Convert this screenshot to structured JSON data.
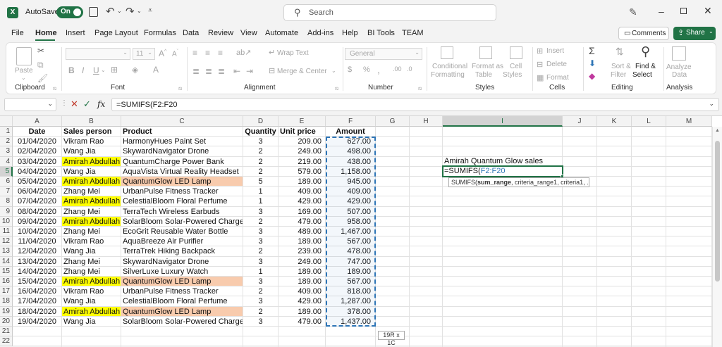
{
  "titlebar": {
    "autosave_label": "AutoSave",
    "toggle_label": "On",
    "search_placeholder": "Search"
  },
  "menu": {
    "tabs": [
      "File",
      "Home",
      "Insert",
      "Page Layout",
      "Formulas",
      "Data",
      "Review",
      "View",
      "Automate",
      "Add-ins",
      "Help",
      "BI Tools",
      "TEAM"
    ],
    "active": "Home",
    "comments_label": "Comments",
    "share_label": "Share"
  },
  "ribbon": {
    "paste": "Paste",
    "clipboard": "Clipboard",
    "font_size": "11",
    "font": "Font",
    "wrap_text": "Wrap Text",
    "merge_center": "Merge & Center",
    "alignment": "Alignment",
    "number_format": "General",
    "number": "Number",
    "conditional": "Conditional",
    "formatting": "Formatting",
    "format_as": "Format as",
    "table": "Table",
    "cell": "Cell",
    "styles_btn": "Styles",
    "styles": "Styles",
    "insert": "Insert",
    "delete": "Delete",
    "format": "Format",
    "cells": "Cells",
    "sort_filter_1": "Sort &",
    "sort_filter_2": "Filter",
    "find_select_1": "Find &",
    "find_select_2": "Select",
    "editing": "Editing",
    "analyze_1": "Analyze",
    "analyze_2": "Data",
    "analysis": "Analysis"
  },
  "formula_bar": {
    "fx": "fx",
    "formula": "=SUMIFS(F2:F20"
  },
  "sheet": {
    "columns": [
      "A",
      "B",
      "C",
      "D",
      "E",
      "F",
      "G",
      "H",
      "I",
      "J",
      "K",
      "L",
      "M"
    ],
    "headers": {
      "date": "Date",
      "person": "Sales person",
      "product": "Product",
      "qty": "Quantity",
      "price": "Unit price",
      "amount": "Amount"
    },
    "rows": [
      {
        "date": "01/04/2020",
        "person": "Vikram Rao",
        "product": "HarmonyHues Paint Set",
        "qty": "3",
        "price": "209.00",
        "amount": "627.00"
      },
      {
        "date": "02/04/2020",
        "person": "Wang Jia",
        "product": "SkywardNavigator Drone",
        "qty": "2",
        "price": "249.00",
        "amount": "498.00"
      },
      {
        "date": "03/04/2020",
        "person": "Amirah Abdullah",
        "product": "QuantumCharge Power Bank",
        "qty": "2",
        "price": "219.00",
        "amount": "438.00"
      },
      {
        "date": "04/04/2020",
        "person": "Wang Jia",
        "product": "AquaVista Virtual Reality Headset",
        "qty": "2",
        "price": "579.00",
        "amount": "1,158.00"
      },
      {
        "date": "05/04/2020",
        "person": "Amirah Abdullah",
        "product": "QuantumGlow LED Lamp",
        "qty": "5",
        "price": "189.00",
        "amount": "945.00"
      },
      {
        "date": "06/04/2020",
        "person": "Zhang Mei",
        "product": "UrbanPulse Fitness Tracker",
        "qty": "1",
        "price": "409.00",
        "amount": "409.00"
      },
      {
        "date": "07/04/2020",
        "person": "Amirah Abdullah",
        "product": "CelestialBloom Floral Perfume",
        "qty": "1",
        "price": "429.00",
        "amount": "429.00"
      },
      {
        "date": "08/04/2020",
        "person": "Zhang Mei",
        "product": "TerraTech Wireless Earbuds",
        "qty": "3",
        "price": "169.00",
        "amount": "507.00"
      },
      {
        "date": "09/04/2020",
        "person": "Amirah Abdullah",
        "product": "SolarBloom Solar-Powered Charger",
        "qty": "2",
        "price": "479.00",
        "amount": "958.00"
      },
      {
        "date": "10/04/2020",
        "person": "Zhang Mei",
        "product": "EcoGrit Reusable Water Bottle",
        "qty": "3",
        "price": "489.00",
        "amount": "1,467.00"
      },
      {
        "date": "11/04/2020",
        "person": "Vikram Rao",
        "product": "AquaBreeze Air Purifier",
        "qty": "3",
        "price": "189.00",
        "amount": "567.00"
      },
      {
        "date": "12/04/2020",
        "person": "Wang Jia",
        "product": "TerraTrek Hiking Backpack",
        "qty": "2",
        "price": "239.00",
        "amount": "478.00"
      },
      {
        "date": "13/04/2020",
        "person": "Zhang Mei",
        "product": "SkywardNavigator Drone",
        "qty": "3",
        "price": "249.00",
        "amount": "747.00"
      },
      {
        "date": "14/04/2020",
        "person": "Zhang Mei",
        "product": "SilverLuxe Luxury Watch",
        "qty": "1",
        "price": "189.00",
        "amount": "189.00"
      },
      {
        "date": "15/04/2020",
        "person": "Amirah Abdullah",
        "product": "QuantumGlow LED Lamp",
        "qty": "3",
        "price": "189.00",
        "amount": "567.00"
      },
      {
        "date": "16/04/2020",
        "person": "Vikram Rao",
        "product": "UrbanPulse Fitness Tracker",
        "qty": "2",
        "price": "409.00",
        "amount": "818.00"
      },
      {
        "date": "17/04/2020",
        "person": "Wang Jia",
        "product": "CelestialBloom Floral Perfume",
        "qty": "3",
        "price": "429.00",
        "amount": "1,287.00"
      },
      {
        "date": "18/04/2020",
        "person": "Amirah Abdullah",
        "product": "QuantumGlow LED Lamp",
        "qty": "2",
        "price": "189.00",
        "amount": "378.00"
      },
      {
        "date": "19/04/2020",
        "person": "Wang Jia",
        "product": "SolarBloom Solar-Powered Charger",
        "qty": "3",
        "price": "479.00",
        "amount": "1,437.00"
      }
    ],
    "row_numbers": [
      "1",
      "2",
      "3",
      "4",
      "5",
      "6",
      "7",
      "8",
      "9",
      "10",
      "11",
      "12",
      "13",
      "14",
      "15",
      "16",
      "17",
      "18",
      "19",
      "20",
      "21",
      "22"
    ],
    "i4": "Amirah Quantum Glow sales",
    "i5_prefix": "=SUMIFS(",
    "i5_ref": "F2:F20",
    "tooltip_fn": "SUMIFS(",
    "tooltip_bold": "sum_range",
    "tooltip_rest": ", criteria_range1, criteria1, ...)",
    "selection_size": "19R x 1C"
  },
  "colors": {
    "highlight_yellow": "#ffff00",
    "highlight_peach": "#f8cbad",
    "excel_green": "#217346",
    "ref_blue": "#2e75b6"
  }
}
